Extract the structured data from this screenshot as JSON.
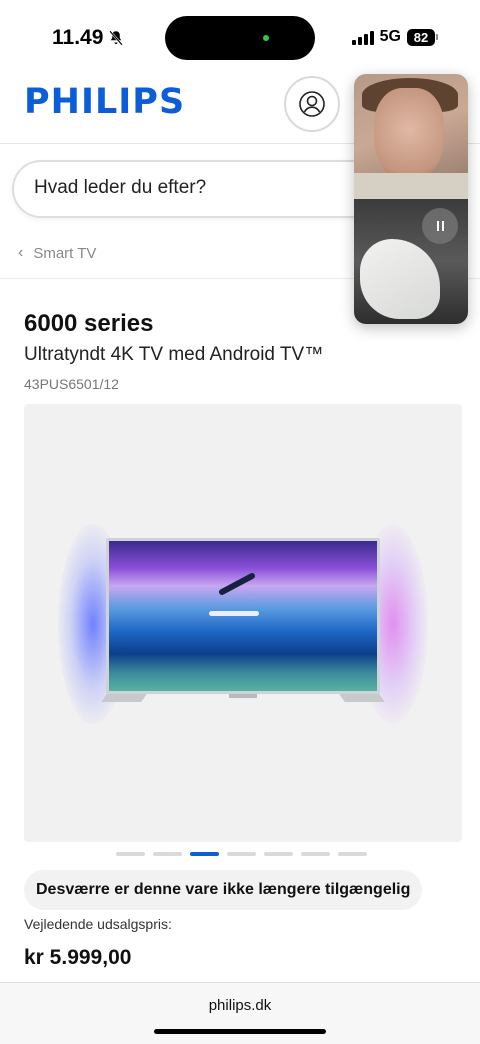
{
  "status_bar": {
    "time": "11.49",
    "network": "5G",
    "battery": "82"
  },
  "header": {
    "logo": "PHILIPS",
    "account_icon": "user-circle-icon"
  },
  "search": {
    "placeholder": "Hvad leder du efter?"
  },
  "breadcrumb": {
    "label": "Smart TV"
  },
  "product": {
    "series": "6000 series",
    "subtitle": "Ultratyndt 4K TV med Android TV™",
    "code": "43PUS6501/12",
    "carousel": {
      "count": 7,
      "active_index": 2
    },
    "unavailable_text": "Desværre er denne vare ikke længere tilgængelig",
    "price_label": "Vejledende udsalgspris:",
    "price": "kr 5.999,00"
  },
  "browser": {
    "url": "philips.dk"
  },
  "colors": {
    "brand": "#0b5ed7"
  }
}
